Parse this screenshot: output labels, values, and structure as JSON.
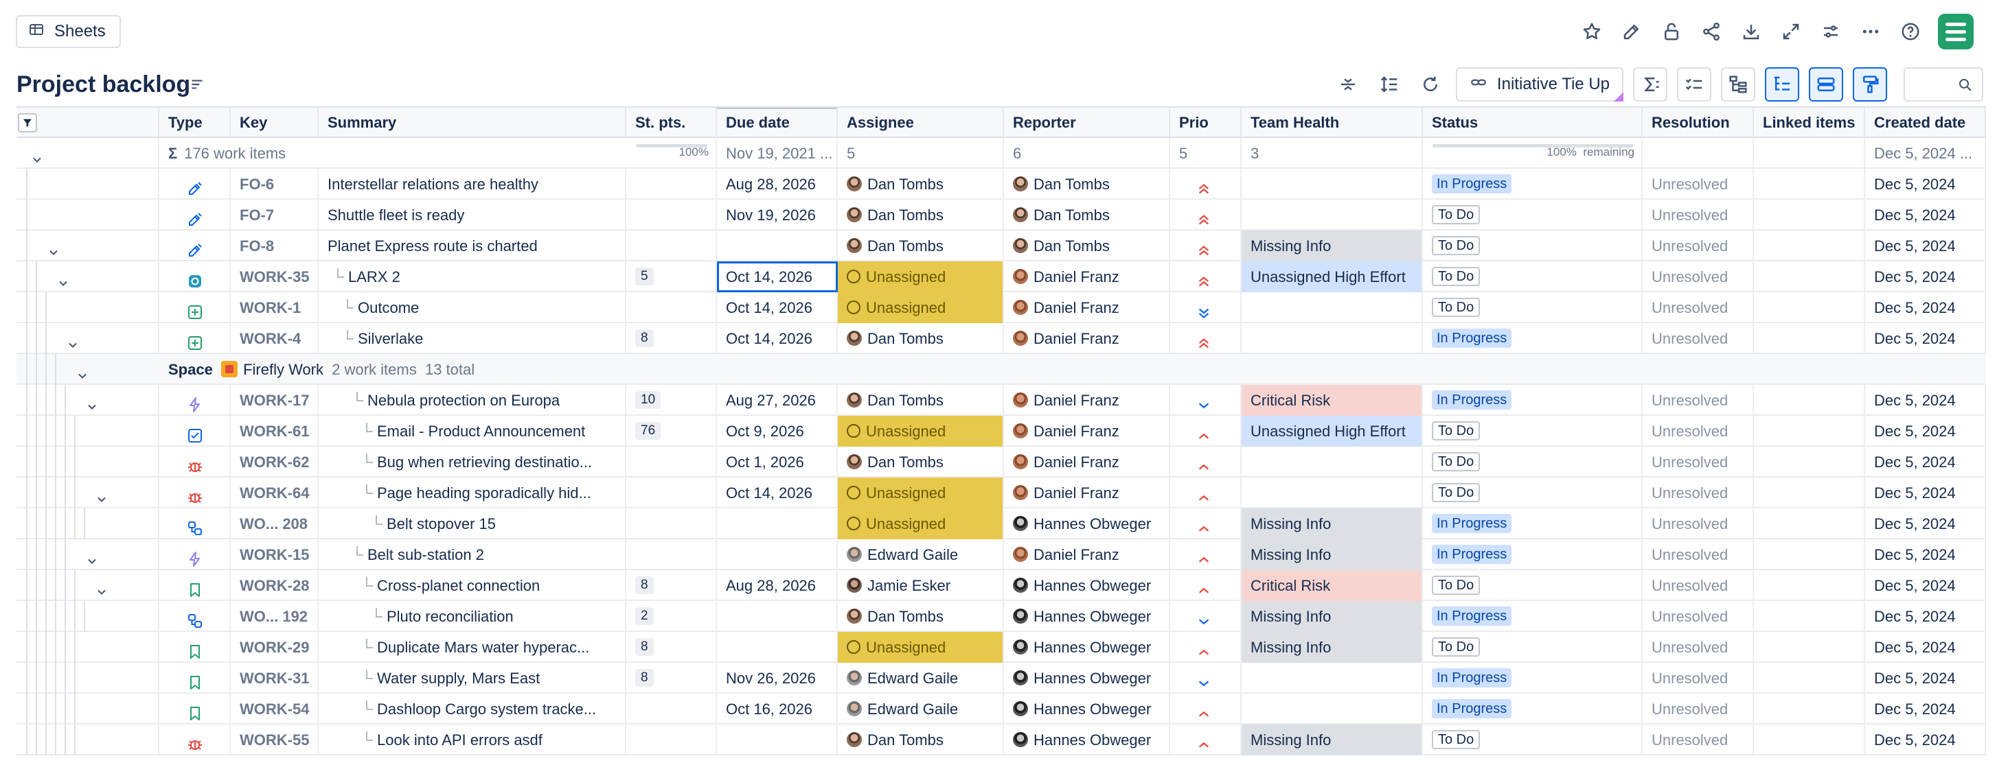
{
  "topbar": {
    "sheets_label": "Sheets"
  },
  "page": {
    "title": "Project backlog"
  },
  "toolbar": {
    "initiative_label": "Initiative Tie Up",
    "search_placeholder": ""
  },
  "columns": {
    "type": "Type",
    "key": "Key",
    "summary": "Summary",
    "points": "St. pts.",
    "due": "Due date",
    "assignee": "Assignee",
    "reporter": "Reporter",
    "prio": "Prio",
    "health": "Team Health",
    "status": "Status",
    "resolution": "Resolution",
    "linked": "Linked items",
    "created": "Created date"
  },
  "summary_row": {
    "work_items": "176 work items",
    "points_pct": "100%",
    "due": "Nov 19, 2021 ...",
    "assignee": "5",
    "reporter": "6",
    "prio": "5",
    "health": "3",
    "status_pct": "100%",
    "status_remaining": "remaining",
    "created": "Dec 5, 2024 ..."
  },
  "space_row": {
    "label": "Space",
    "name": "Firefly Work",
    "items": "2 work items",
    "total": "13 total"
  },
  "rows": [
    {
      "type_icon": "goal",
      "key": "FO-6",
      "summary": "Interstellar relations are healthy",
      "points": "",
      "due": "Aug 28, 2026",
      "assignee": "Dan Tombs",
      "assignee_av": "dan",
      "reporter": "Dan Tombs",
      "reporter_av": "dan",
      "prio": "highest",
      "health": "",
      "health_style": "",
      "status": "In Progress",
      "resolution": "Unresolved",
      "linked": "",
      "created": "Dec 5, 2024"
    },
    {
      "type_icon": "goal",
      "key": "FO-7",
      "summary": "Shuttle fleet is ready",
      "points": "",
      "due": "Nov 19, 2026",
      "assignee": "Dan Tombs",
      "assignee_av": "dan",
      "reporter": "Dan Tombs",
      "reporter_av": "dan",
      "prio": "highest",
      "health": "",
      "health_style": "",
      "status": "To Do",
      "resolution": "Unresolved",
      "linked": "",
      "created": "Dec 5, 2024"
    },
    {
      "type_icon": "goal",
      "key": "FO-8",
      "summary": "Planet Express route is charted",
      "points": "",
      "due": "",
      "assignee": "Dan Tombs",
      "assignee_av": "dan",
      "reporter": "Dan Tombs",
      "reporter_av": "dan",
      "prio": "highest",
      "health": "Missing Info",
      "health_style": "gray",
      "status": "To Do",
      "resolution": "Unresolved",
      "linked": "",
      "created": "Dec 5, 2024"
    },
    {
      "type_icon": "initiative",
      "key": "WORK-35",
      "summary": "LARX 2",
      "points": "5",
      "due": "Oct 14, 2026",
      "due_selected": true,
      "assignee": "Unassigned",
      "assignee_av": "un",
      "reporter": "Daniel Franz",
      "reporter_av": "daniel",
      "prio": "highest",
      "health": "Unassigned High Effort",
      "health_style": "blue",
      "status": "To Do",
      "resolution": "Unresolved",
      "linked": "",
      "created": "Dec 5, 2024"
    },
    {
      "type_icon": "plus",
      "key": "WORK-1",
      "summary": "Outcome",
      "points": "",
      "due": "Oct 14, 2026",
      "assignee": "Unassigned",
      "assignee_av": "un",
      "reporter": "Daniel Franz",
      "reporter_av": "daniel",
      "prio": "lowest",
      "health": "",
      "health_style": "",
      "status": "To Do",
      "resolution": "Unresolved",
      "linked": "",
      "created": "Dec 5, 2024"
    },
    {
      "type_icon": "plus",
      "key": "WORK-4",
      "summary": "Silverlake",
      "points": "8",
      "due": "Oct 14, 2026",
      "assignee": "Dan Tombs",
      "assignee_av": "dan",
      "reporter": "Daniel Franz",
      "reporter_av": "daniel",
      "prio": "highest",
      "health": "",
      "health_style": "",
      "status": "In Progress",
      "resolution": "Unresolved",
      "linked": "",
      "created": "Dec 5, 2024"
    },
    {
      "type_icon": "epic",
      "key": "WORK-17",
      "summary": "Nebula protection on Europa",
      "points": "10",
      "due": "Aug 27, 2026",
      "assignee": "Dan Tombs",
      "assignee_av": "dan",
      "reporter": "Daniel Franz",
      "reporter_av": "daniel",
      "prio": "low",
      "health": "Critical Risk",
      "health_style": "red",
      "status": "In Progress",
      "resolution": "Unresolved",
      "linked": "",
      "created": "Dec 5, 2024"
    },
    {
      "type_icon": "task",
      "key": "WORK-61",
      "summary": "Email - Product Announcement",
      "points": "76",
      "due": "Oct 9, 2026",
      "assignee": "Unassigned",
      "assignee_av": "un",
      "reporter": "Daniel Franz",
      "reporter_av": "daniel",
      "prio": "high",
      "health": "Unassigned High Effort",
      "health_style": "blue",
      "status": "To Do",
      "resolution": "Unresolved",
      "linked": "",
      "created": "Dec 5, 2024"
    },
    {
      "type_icon": "bug",
      "key": "WORK-62",
      "summary": "Bug when retrieving destinatio...",
      "points": "",
      "due": "Oct 1, 2026",
      "assignee": "Dan Tombs",
      "assignee_av": "dan",
      "reporter": "Daniel Franz",
      "reporter_av": "daniel",
      "prio": "high",
      "health": "",
      "health_style": "",
      "status": "To Do",
      "resolution": "Unresolved",
      "linked": "",
      "created": "Dec 5, 2024"
    },
    {
      "type_icon": "bug",
      "key": "WORK-64",
      "summary": "Page heading sporadically hid...",
      "points": "",
      "due": "Oct 14, 2026",
      "assignee": "Unassigned",
      "assignee_av": "un",
      "reporter": "Daniel Franz",
      "reporter_av": "daniel",
      "prio": "high",
      "health": "",
      "health_style": "",
      "status": "To Do",
      "resolution": "Unresolved",
      "linked": "",
      "created": "Dec 5, 2024"
    },
    {
      "type_icon": "subtask",
      "key": "WO... 208",
      "summary": "Belt stopover 15",
      "points": "",
      "due": "",
      "assignee": "Unassigned",
      "assignee_av": "un",
      "reporter": "Hannes Obweger",
      "reporter_av": "hannes",
      "prio": "high",
      "health": "Missing Info",
      "health_style": "gray",
      "status": "In Progress",
      "resolution": "Unresolved",
      "linked": "",
      "created": "Dec 5, 2024"
    },
    {
      "type_icon": "epic",
      "key": "WORK-15",
      "summary": "Belt sub-station 2",
      "points": "",
      "due": "",
      "assignee": "Edward Gaile",
      "assignee_av": "edward",
      "reporter": "Daniel Franz",
      "reporter_av": "daniel",
      "prio": "high",
      "health": "Missing Info",
      "health_style": "gray",
      "status": "In Progress",
      "resolution": "Unresolved",
      "linked": "",
      "created": "Dec 5, 2024"
    },
    {
      "type_icon": "story",
      "key": "WORK-28",
      "summary": "Cross-planet connection",
      "points": "8",
      "due": "Aug 28, 2026",
      "assignee": "Jamie Esker",
      "assignee_av": "jamie",
      "reporter": "Hannes Obweger",
      "reporter_av": "hannes",
      "prio": "high",
      "health": "Critical Risk",
      "health_style": "red",
      "status": "To Do",
      "resolution": "Unresolved",
      "linked": "",
      "created": "Dec 5, 2024"
    },
    {
      "type_icon": "subtask",
      "key": "WO... 192",
      "summary": "Pluto reconciliation",
      "points": "2",
      "due": "",
      "assignee": "Dan Tombs",
      "assignee_av": "dan",
      "reporter": "Hannes Obweger",
      "reporter_av": "hannes",
      "prio": "low",
      "health": "Missing Info",
      "health_style": "gray",
      "status": "In Progress",
      "resolution": "Unresolved",
      "linked": "",
      "created": "Dec 5, 2024"
    },
    {
      "type_icon": "story",
      "key": "WORK-29",
      "summary": "Duplicate Mars water hyperac...",
      "points": "8",
      "due": "",
      "assignee": "Unassigned",
      "assignee_av": "un",
      "reporter": "Hannes Obweger",
      "reporter_av": "hannes",
      "prio": "high",
      "health": "Missing Info",
      "health_style": "gray",
      "status": "To Do",
      "resolution": "Unresolved",
      "linked": "",
      "created": "Dec 5, 2024"
    },
    {
      "type_icon": "story",
      "key": "WORK-31",
      "summary": "Water supply, Mars East",
      "points": "8",
      "due": "Nov 26, 2026",
      "assignee": "Edward Gaile",
      "assignee_av": "edward",
      "reporter": "Hannes Obweger",
      "reporter_av": "hannes",
      "prio": "low",
      "health": "",
      "health_style": "",
      "status": "In Progress",
      "resolution": "Unresolved",
      "linked": "",
      "created": "Dec 5, 2024"
    },
    {
      "type_icon": "story",
      "key": "WORK-54",
      "summary": "Dashloop Cargo system tracke...",
      "points": "",
      "due": "Oct 16, 2026",
      "assignee": "Edward Gaile",
      "assignee_av": "edward",
      "reporter": "Hannes Obweger",
      "reporter_av": "hannes",
      "prio": "high",
      "health": "",
      "health_style": "",
      "status": "In Progress",
      "resolution": "Unresolved",
      "linked": "",
      "created": "Dec 5, 2024"
    },
    {
      "type_icon": "bug",
      "key": "WORK-55",
      "summary": "Look into API errors asdf",
      "points": "",
      "due": "",
      "assignee": "Dan Tombs",
      "assignee_av": "dan",
      "reporter": "Hannes Obweger",
      "reporter_av": "hannes",
      "prio": "high",
      "health": "Missing Info",
      "health_style": "gray",
      "status": "To Do",
      "resolution": "Unresolved",
      "linked": "",
      "created": "Dec 5, 2024"
    }
  ],
  "colors": {
    "accent": "#0c66e4",
    "unassigned": "#e6c84a",
    "critical": "#f8d4d0",
    "effort": "#cfe1fd",
    "missing": "#dcdfe4",
    "prio_high": "#e2483d",
    "prio_low": "#0c66e4"
  }
}
